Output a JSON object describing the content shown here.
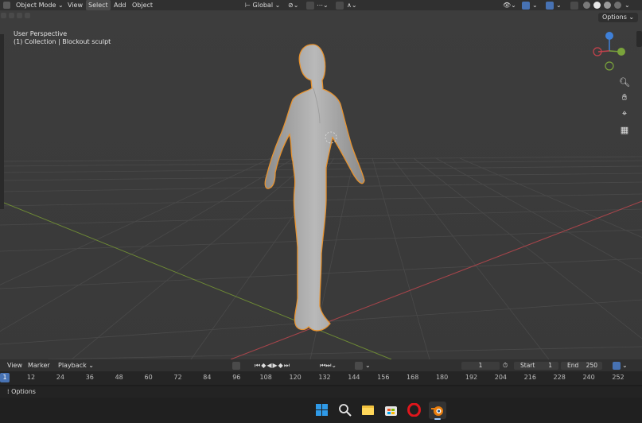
{
  "header": {
    "mode": "Object Mode",
    "menus": [
      "View",
      "Select",
      "Add",
      "Object"
    ],
    "transform_orientation": "Global"
  },
  "viewport": {
    "perspective_label": "User Perspective",
    "collection_label": "(1) Collection | Blockout sculpt",
    "options_label": "Options",
    "gizmo": {
      "x": "X",
      "y": "Y",
      "z": "Z"
    },
    "colors": {
      "x_axis": "#c8424c",
      "y_axis": "#7aa33b",
      "z_axis": "#3f80d8",
      "selection_outline": "#e8932f"
    }
  },
  "timeline": {
    "menus": [
      "View",
      "Marker",
      "Playback"
    ],
    "current_frame": "1",
    "start_label": "Start",
    "start_value": "1",
    "end_label": "End",
    "end_value": "250",
    "ticks": [
      "1",
      "12",
      "24",
      "36",
      "48",
      "60",
      "72",
      "84",
      "96",
      "108",
      "120",
      "132",
      "144",
      "156",
      "168",
      "180",
      "192",
      "204",
      "216",
      "228",
      "240",
      "252"
    ]
  },
  "status": {
    "options_label": "Options"
  },
  "taskbar": {
    "icons": [
      "windows-start-icon",
      "search-icon",
      "file-explorer-icon",
      "store-icon",
      "opera-icon",
      "blender-icon"
    ]
  }
}
